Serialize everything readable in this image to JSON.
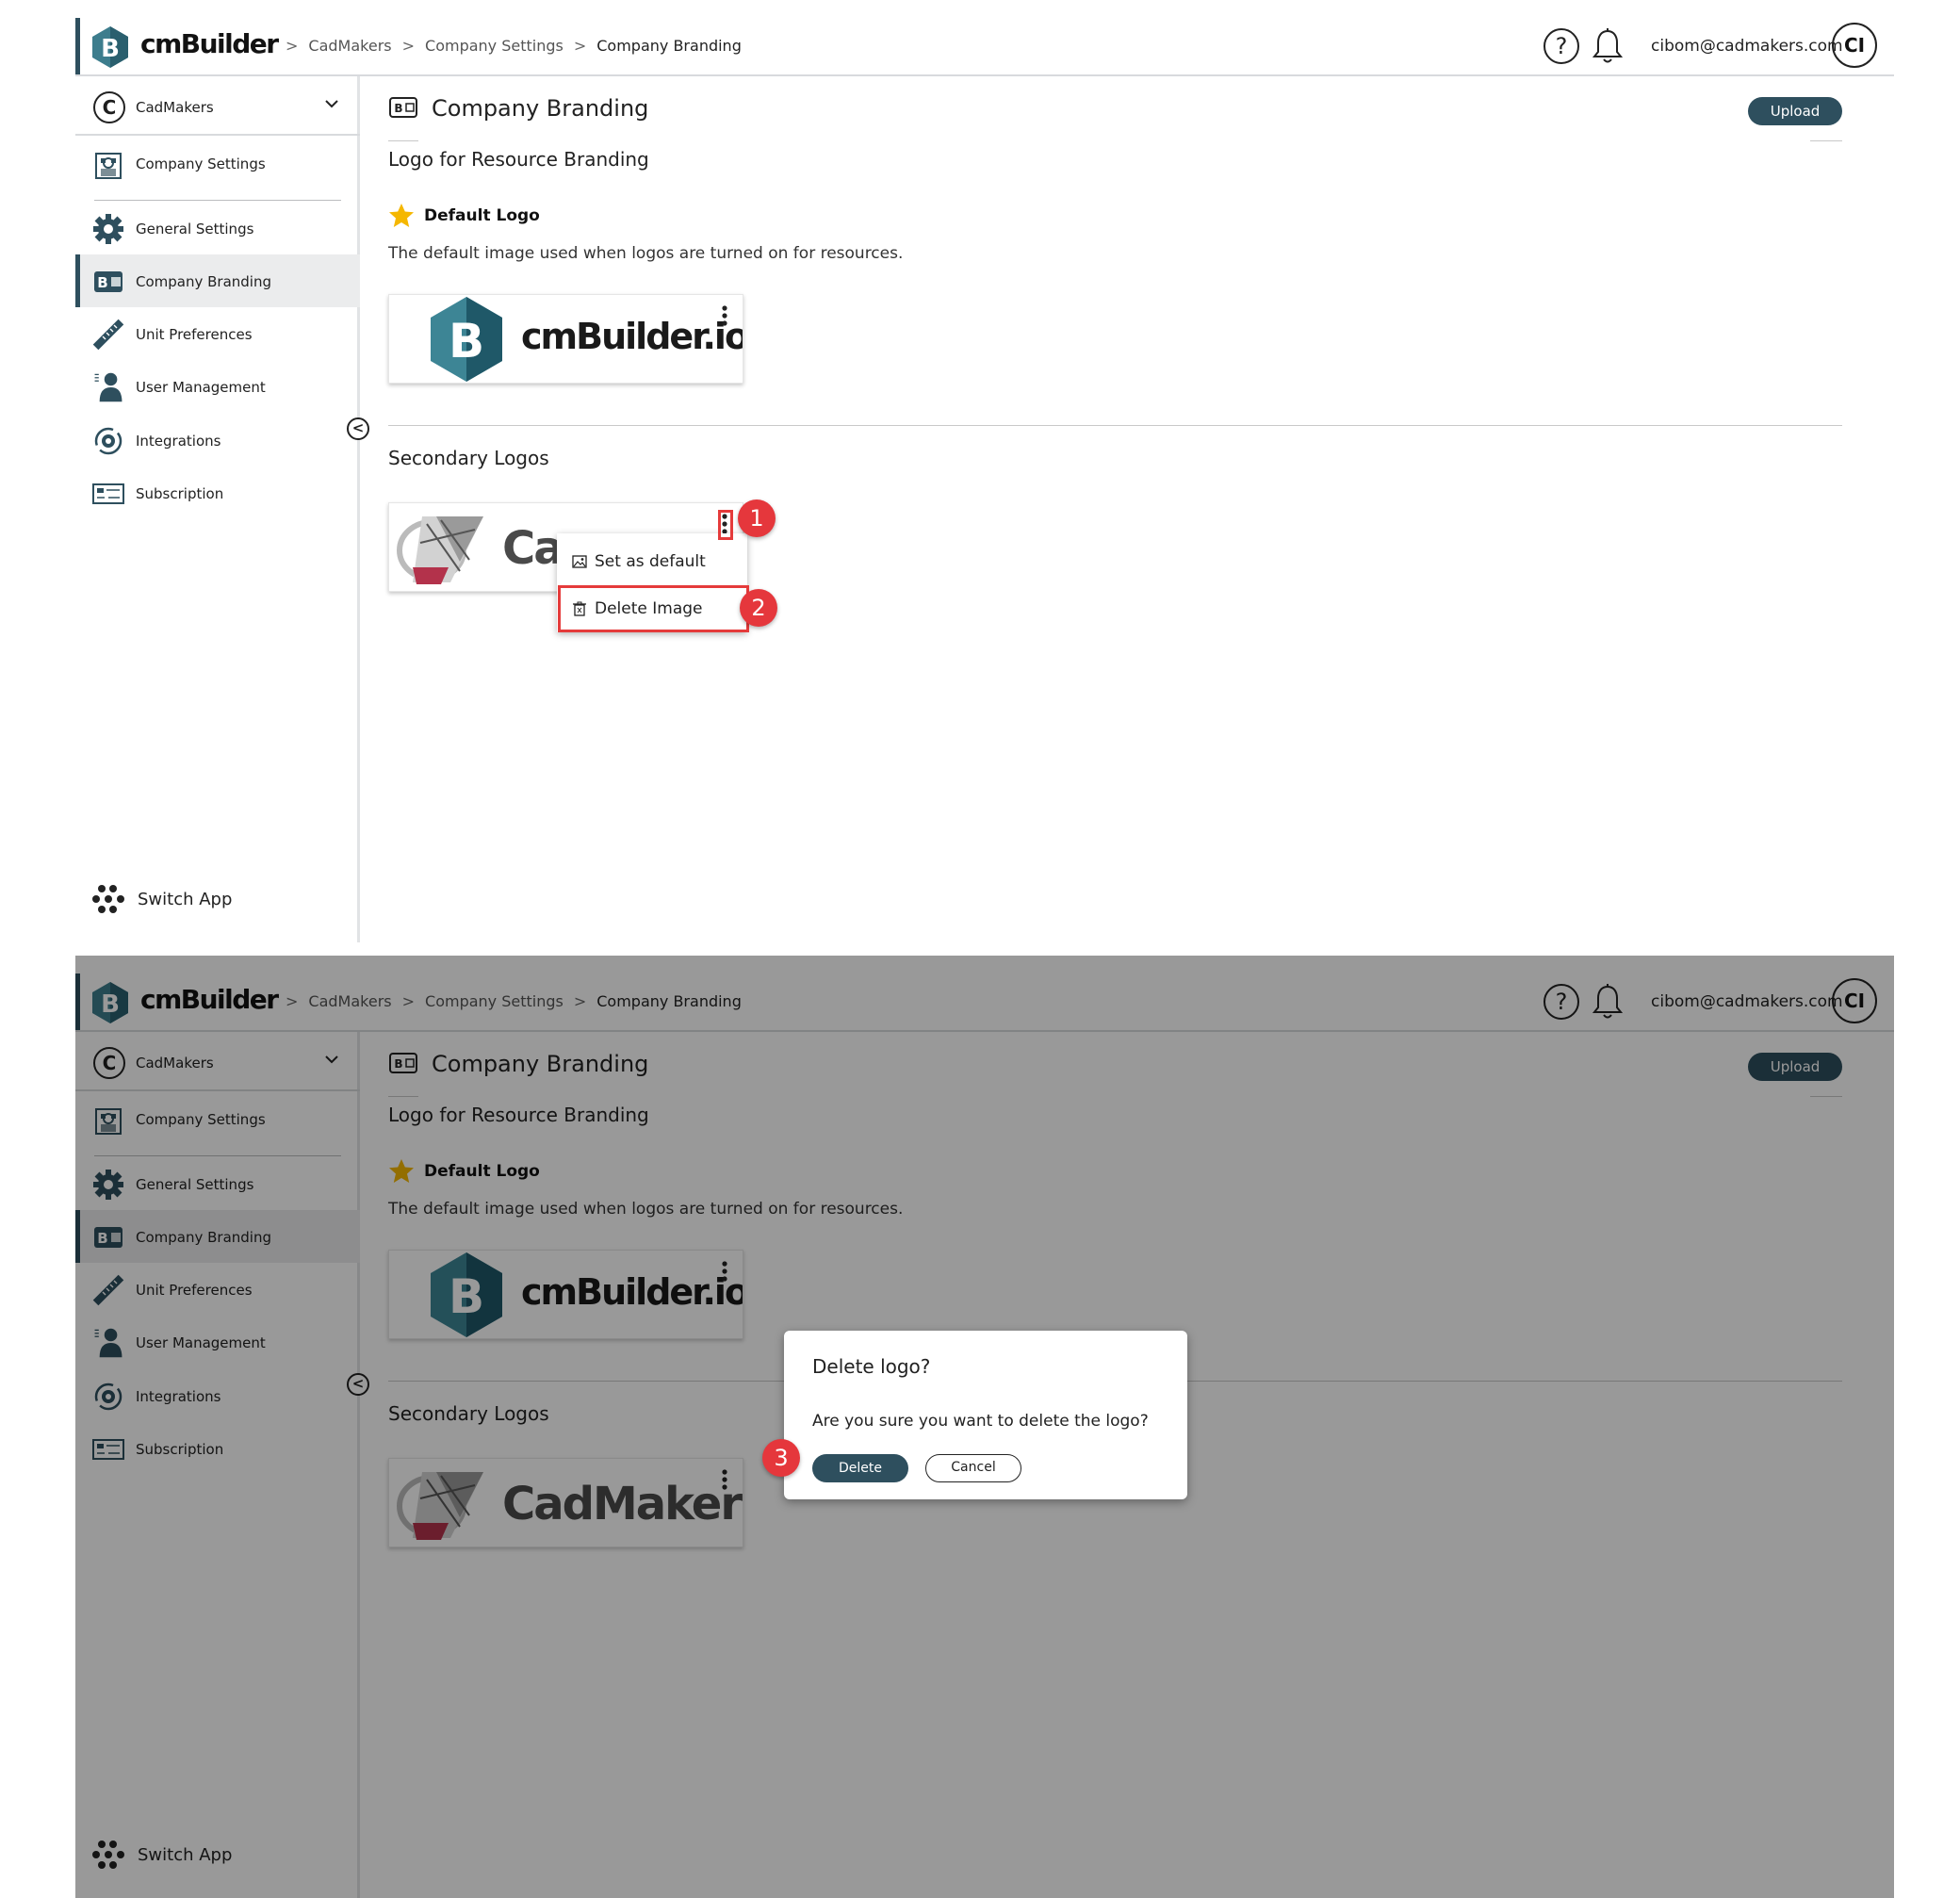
{
  "app": {
    "name": "cmBuilder"
  },
  "breadcrumb": [
    "CadMakers",
    "Company Settings",
    "Company Branding"
  ],
  "header": {
    "help_symbol": "?",
    "email": "cibom@cadmakers.com",
    "avatar_initials": "CI"
  },
  "sidebar": {
    "company": {
      "initial": "C",
      "name": "CadMakers"
    },
    "items": [
      {
        "label": "Company Settings",
        "icon": "building-icon"
      },
      {
        "label": "General Settings",
        "icon": "gear-icon"
      },
      {
        "label": "Company Branding",
        "icon": "branding-icon",
        "active": true
      },
      {
        "label": "Unit Preferences",
        "icon": "ruler-icon"
      },
      {
        "label": "User Management",
        "icon": "user-icon"
      },
      {
        "label": "Integrations",
        "icon": "integrations-icon"
      },
      {
        "label": "Subscription",
        "icon": "subscription-icon"
      }
    ],
    "collapse_symbol": "<",
    "switch_app": "Switch App"
  },
  "main": {
    "title": "Company Branding",
    "upload_label": "Upload",
    "section_title": "Logo for Resource Branding",
    "default_logo_label": "Default Logo",
    "default_logo_desc": "The default image used when logos are turned on for resources.",
    "default_logo_card_text": "cmBuilder.io",
    "secondary_title": "Secondary Logos",
    "secondary_logo_text": "CadMakers",
    "secondary_logo_text_partial": "Ca"
  },
  "menu": {
    "items": [
      "Set as default",
      "Delete Image"
    ]
  },
  "dialog": {
    "title": "Delete logo?",
    "message": "Are you sure you want to delete the logo?",
    "confirm": "Delete",
    "cancel": "Cancel"
  },
  "steps": [
    "1",
    "2",
    "3"
  ],
  "colors": {
    "primary": "#2e4f5e",
    "highlight": "#e53b3b",
    "star": "#f5b700",
    "overlay": "rgba(0,0,0,0.4)"
  }
}
